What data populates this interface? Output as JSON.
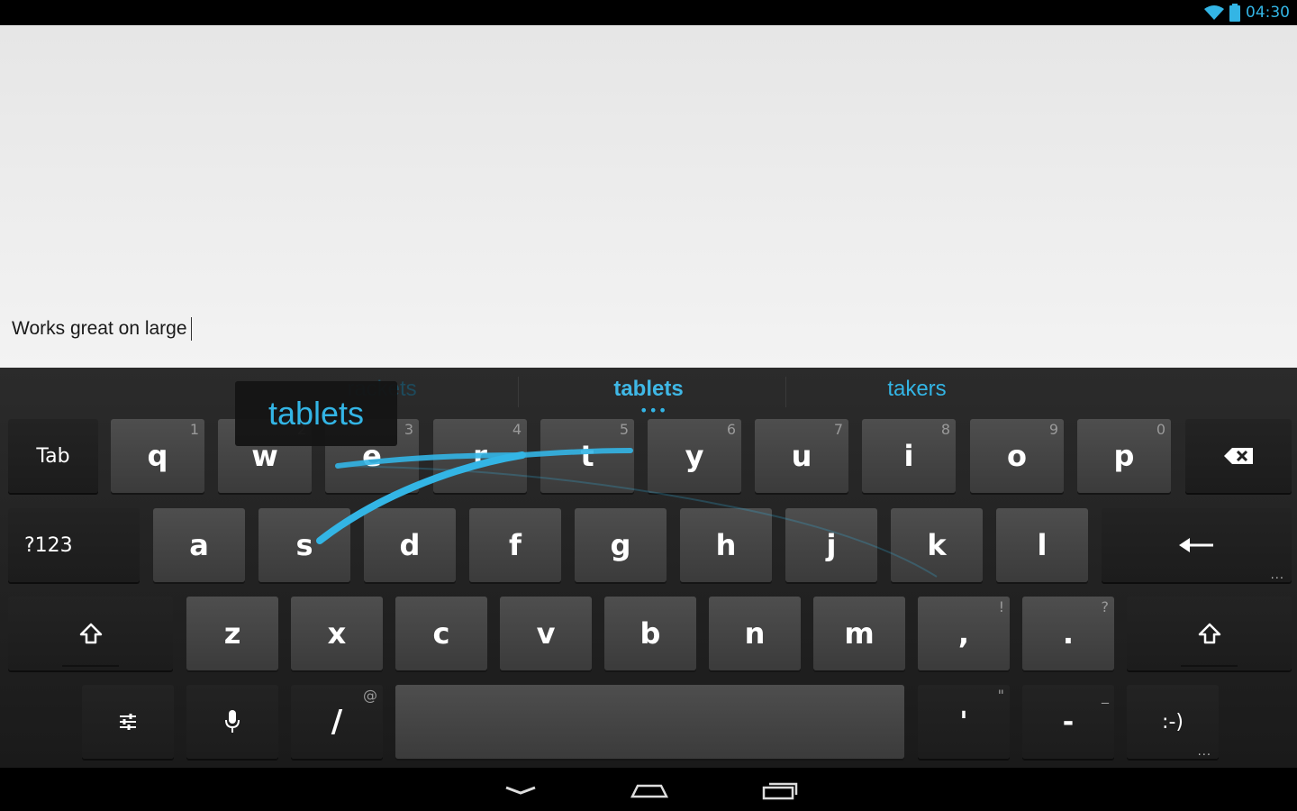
{
  "status_bar": {
    "time": "04:30",
    "icons": [
      "wifi-icon",
      "battery-icon"
    ],
    "accent": "#33b5e5"
  },
  "editor": {
    "text": "Works great on large"
  },
  "suggestions": {
    "left": "rackets",
    "center": "tablets",
    "right": "takers",
    "more_indicator": "•••"
  },
  "gesture_preview": {
    "word": "tablets"
  },
  "keyboard": {
    "row1": {
      "tab": "Tab",
      "keys": [
        {
          "label": "q",
          "hint": "1"
        },
        {
          "label": "w",
          "hint": "2"
        },
        {
          "label": "e",
          "hint": "3"
        },
        {
          "label": "r",
          "hint": "4"
        },
        {
          "label": "t",
          "hint": "5"
        },
        {
          "label": "y",
          "hint": "6"
        },
        {
          "label": "u",
          "hint": "7"
        },
        {
          "label": "i",
          "hint": "8"
        },
        {
          "label": "o",
          "hint": "9"
        },
        {
          "label": "p",
          "hint": "0"
        }
      ],
      "backspace_icon": "backspace-icon"
    },
    "row2": {
      "symbols": "?123",
      "keys": [
        {
          "label": "a"
        },
        {
          "label": "s"
        },
        {
          "label": "d"
        },
        {
          "label": "f"
        },
        {
          "label": "g"
        },
        {
          "label": "h"
        },
        {
          "label": "j"
        },
        {
          "label": "k"
        },
        {
          "label": "l"
        }
      ],
      "enter_icon": "enter-icon",
      "enter_more": "..."
    },
    "row3": {
      "shift_icon": "shift-icon",
      "keys": [
        {
          "label": "z"
        },
        {
          "label": "x"
        },
        {
          "label": "c"
        },
        {
          "label": "v"
        },
        {
          "label": "b"
        },
        {
          "label": "n"
        },
        {
          "label": "m"
        },
        {
          "label": ",",
          "hint": "!"
        },
        {
          "label": ".",
          "hint": "?"
        }
      ]
    },
    "row4": {
      "settings_icon": "settings-sliders-icon",
      "mic_icon": "microphone-icon",
      "slash": {
        "label": "/",
        "hint": "@"
      },
      "space": "",
      "apostrophe": {
        "label": "'",
        "hint": "\""
      },
      "dash": {
        "label": "-",
        "hint": "_"
      },
      "smiley": {
        "label": ":-)",
        "more": "..."
      }
    }
  },
  "nav_bar": {
    "icons": [
      "hide-keyboard-icon",
      "home-icon",
      "recent-apps-icon"
    ]
  },
  "colors": {
    "accent": "#33b5e5",
    "key": "#444444",
    "func_key": "#202020",
    "editor_bg": "#ececec"
  }
}
